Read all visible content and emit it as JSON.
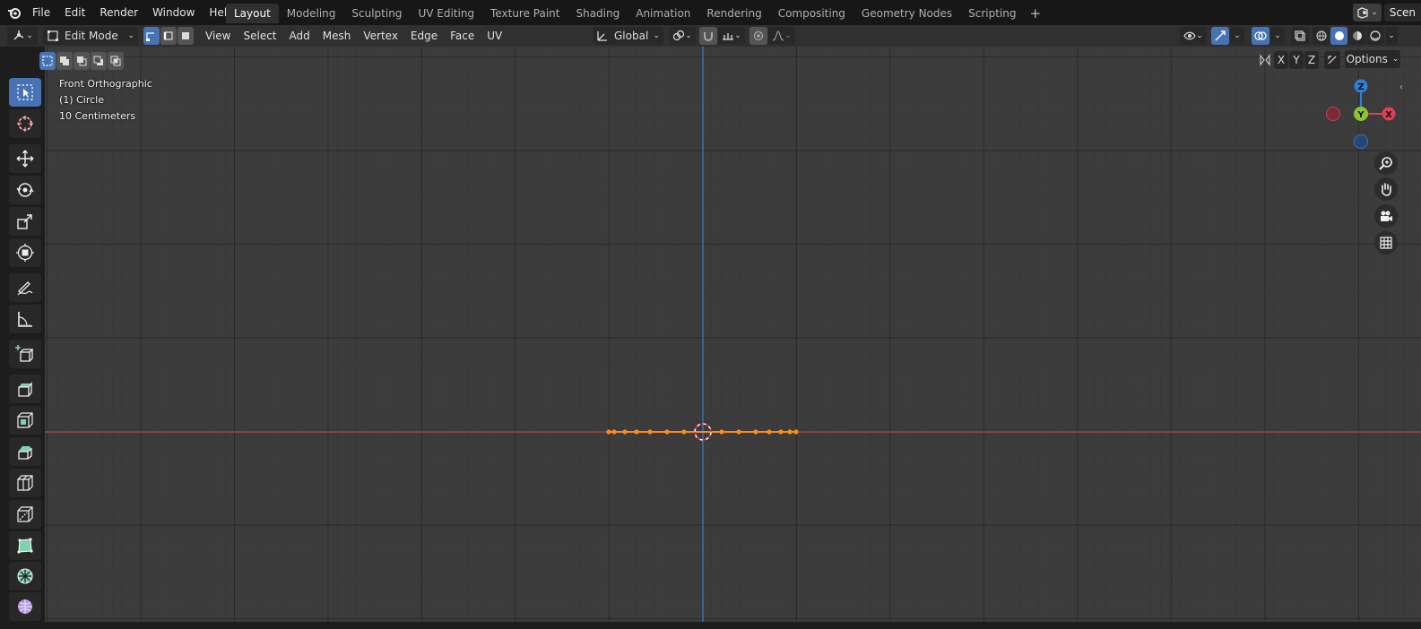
{
  "topbar": {
    "menu": [
      "File",
      "Edit",
      "Render",
      "Window",
      "Help"
    ],
    "workspaces": [
      "Layout",
      "Modeling",
      "Sculpting",
      "UV Editing",
      "Texture Paint",
      "Shading",
      "Animation",
      "Rendering",
      "Compositing",
      "Geometry Nodes",
      "Scripting"
    ],
    "active_workspace": "Layout",
    "add_workspace": "+",
    "scene_label": "Scen"
  },
  "header": {
    "mode": "Edit Mode",
    "menus": [
      "View",
      "Select",
      "Add",
      "Mesh",
      "Vertex",
      "Edge",
      "Face",
      "UV"
    ],
    "orientation": "Global",
    "options_label": "Options",
    "axis_x": "X",
    "axis_y": "Y",
    "axis_z": "Z"
  },
  "viewport": {
    "view_name": "Front Orthographic",
    "object_name": "(1) Circle",
    "scale_text": "10 Centimeters"
  },
  "gizmo": {
    "z_label": "Z",
    "y_label": "Y",
    "x_label": "X"
  },
  "colors": {
    "x_axis": "#c04040",
    "z_axis": "#3e77c7",
    "selection": "#ff8c1a",
    "active_tool": "#4772b3",
    "gizmo_x": "#e0404f",
    "gizmo_y": "#8bc630",
    "gizmo_z": "#2e7fd8"
  },
  "icons": {
    "toolbar": [
      "select-box-icon",
      "cursor-icon",
      "move-icon",
      "rotate-icon",
      "scale-icon",
      "transform-icon",
      "annotate-icon",
      "measure-icon",
      "add-cube-icon",
      "extrude-icon",
      "inset-icon",
      "bevel-icon",
      "loop-cut-icon",
      "knife-icon",
      "poly-build-icon",
      "spin-icon",
      "smooth-icon"
    ],
    "nav": [
      "zoom-icon",
      "hand-icon",
      "camera-icon",
      "grid-icon"
    ]
  }
}
